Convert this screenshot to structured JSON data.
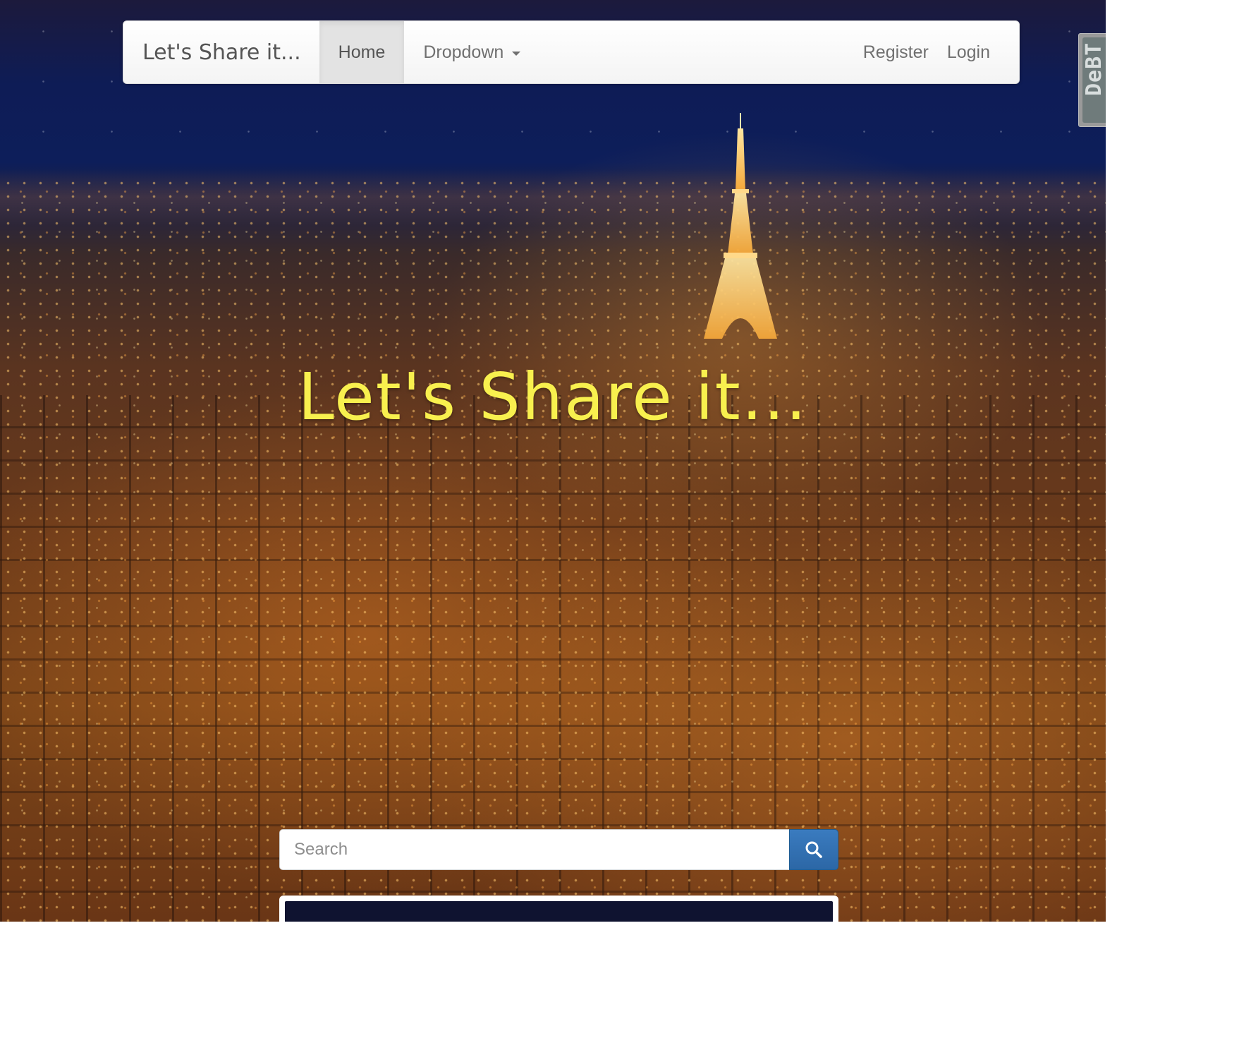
{
  "navbar": {
    "brand": "Let's Share it...",
    "items": [
      {
        "label": "Home",
        "active": true
      },
      {
        "label": "Dropdown",
        "has_caret": true
      }
    ],
    "right_items": [
      {
        "label": "Register"
      },
      {
        "label": "Login"
      }
    ]
  },
  "hero": {
    "title": "Let's Share it...",
    "title_color": "#f8f04e"
  },
  "search": {
    "placeholder": "Search",
    "value": "",
    "button_icon": "search-icon",
    "button_color": "#2f6fae"
  },
  "side_widget": {
    "label": "DeBT"
  },
  "background": {
    "description_icon": "night-city-skyline"
  }
}
